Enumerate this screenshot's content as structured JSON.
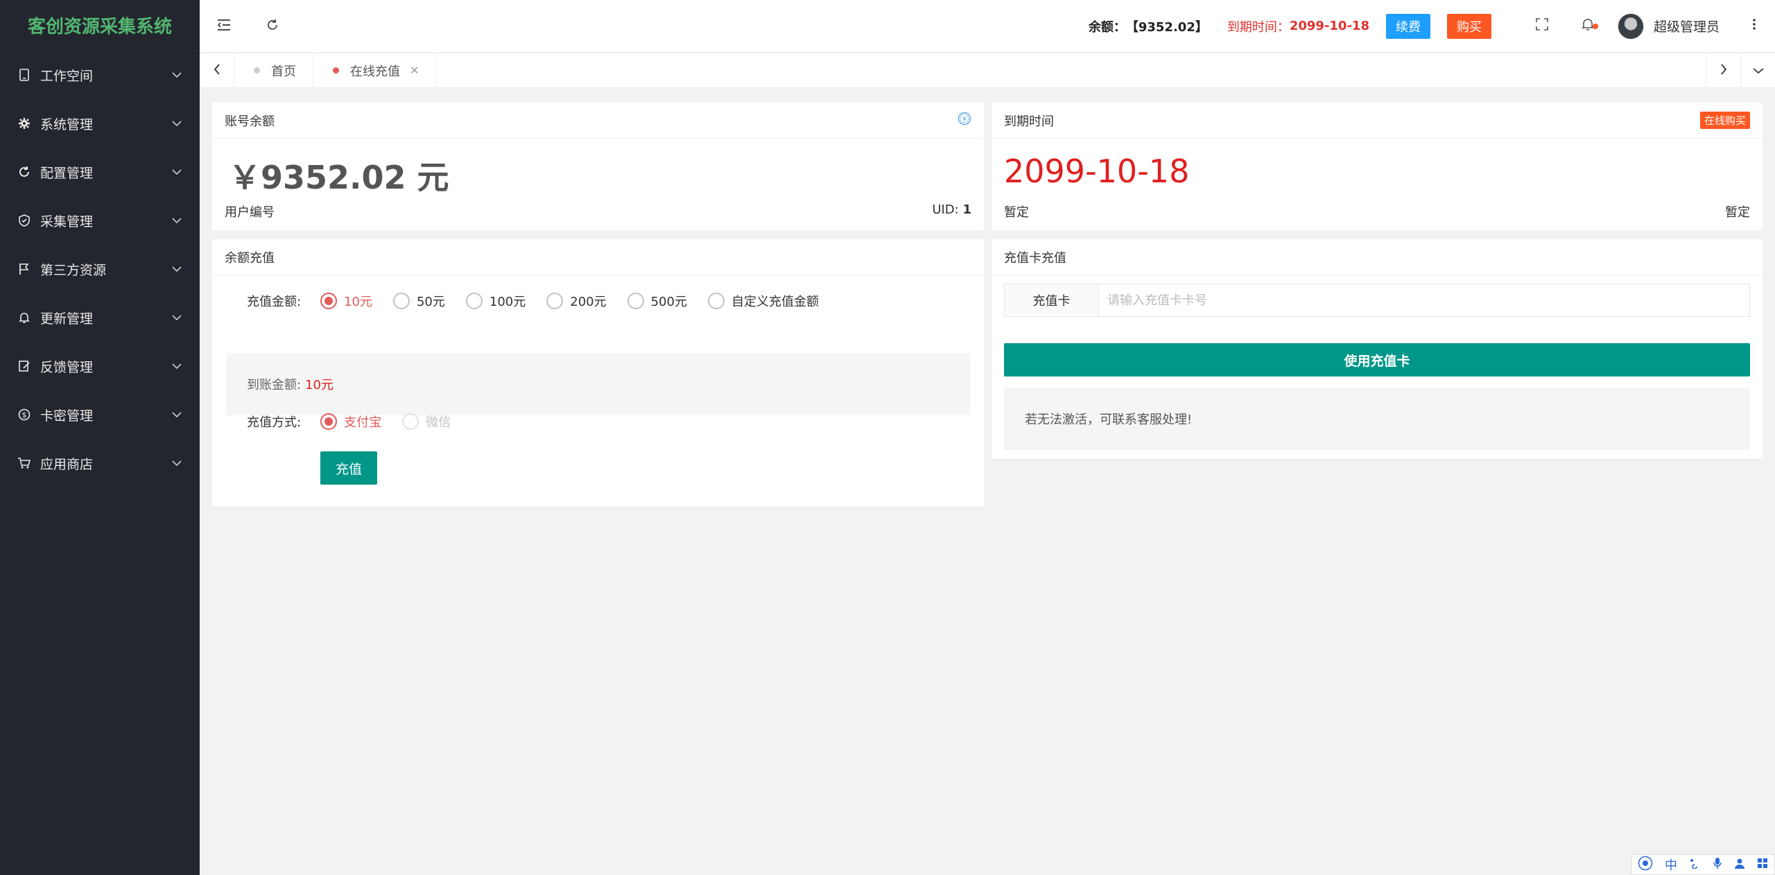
{
  "app": {
    "title": "客创资源采集系统"
  },
  "sidebar": {
    "items": [
      {
        "label": "工作空间",
        "icon": "tablet-icon"
      },
      {
        "label": "系统管理",
        "icon": "gear-icon"
      },
      {
        "label": "配置管理",
        "icon": "refresh-icon"
      },
      {
        "label": "采集管理",
        "icon": "shield-icon"
      },
      {
        "label": "第三方资源",
        "icon": "flag-icon"
      },
      {
        "label": "更新管理",
        "icon": "bell-icon"
      },
      {
        "label": "反馈管理",
        "icon": "edit-icon"
      },
      {
        "label": "卡密管理",
        "icon": "dollar-icon"
      },
      {
        "label": "应用商店",
        "icon": "cart-icon"
      }
    ]
  },
  "header": {
    "balance_label": "余额：",
    "balance_value": "【9352.02】",
    "expire_label": "到期时间：",
    "expire_value": "2099-10-18",
    "renew_label": "续费",
    "buy_label": "购买",
    "username": "超级管理员"
  },
  "tabs": [
    {
      "label": "首页",
      "active": false
    },
    {
      "label": "在线充值",
      "active": true,
      "close": "✕"
    }
  ],
  "balance_card": {
    "title": "账号余额",
    "amount": "￥9352.02 元",
    "user_label": "用户编号",
    "uid_label": "UID: ",
    "uid_value": "1"
  },
  "expire_card": {
    "title": "到期时间",
    "badge": "在线购买",
    "date": "2099-10-18",
    "left_note": "暂定",
    "right_note": "暂定"
  },
  "recharge": {
    "title": "余额充值",
    "amount_label": "充值金额:",
    "amount_options": [
      "10元",
      "50元",
      "100元",
      "200元",
      "500元",
      "自定义充值金额"
    ],
    "selected_index": 0,
    "arrival_label": "到账金额:",
    "arrival_value": "10元",
    "method_label": "充值方式:",
    "methods": [
      "支付宝",
      "微信"
    ],
    "submit_label": "充值"
  },
  "card_recharge": {
    "title": "充值卡充值",
    "input_label": "充值卡",
    "input_placeholder": "请输入充值卡卡号",
    "use_label": "使用充值卡",
    "tip": "若无法激活，可联系客服处理!"
  },
  "ime": {
    "lang": "中"
  },
  "colors": {
    "sidebar_bg": "#23262e",
    "logo": "#52b570",
    "accent_teal": "#009688",
    "accent_red": "#e01f1f",
    "renew_blue": "#1e9fff",
    "buy_orange": "#ff5722"
  }
}
